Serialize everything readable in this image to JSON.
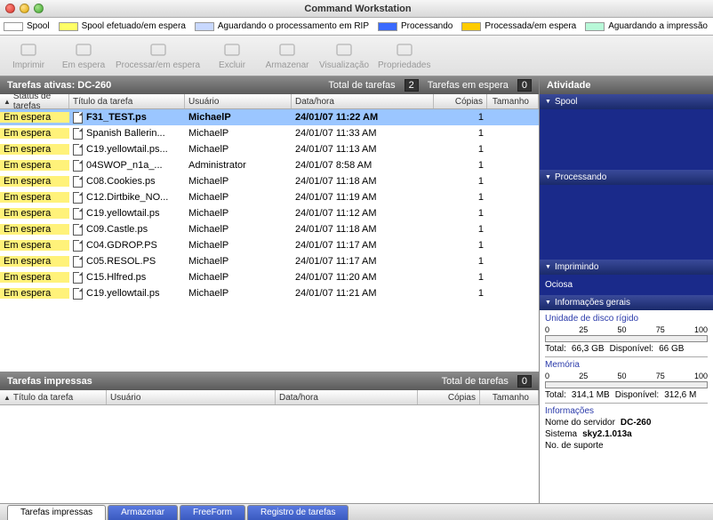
{
  "window": {
    "title": "Command Workstation"
  },
  "legend": [
    {
      "color": "#ffffff",
      "label": "Spool"
    },
    {
      "color": "#ffff66",
      "label": "Spool efetuado/em espera"
    },
    {
      "color": "#c8d8ff",
      "label": "Aguardando o processamento em RIP"
    },
    {
      "color": "#3a6aff",
      "label": "Processando"
    },
    {
      "color": "#ffcc00",
      "label": "Processada/em espera"
    },
    {
      "color": "#b8f8d8",
      "label": "Aguardando a impressão"
    }
  ],
  "toolbar": [
    {
      "name": "print-button",
      "label": "Imprimir"
    },
    {
      "name": "hold-button",
      "label": "Em espera"
    },
    {
      "name": "process-hold-button",
      "label": "Processar/em espera"
    },
    {
      "name": "delete-button",
      "label": "Excluir"
    },
    {
      "name": "archive-button",
      "label": "Armazenar"
    },
    {
      "name": "preview-button",
      "label": "Visualização"
    },
    {
      "name": "properties-button",
      "label": "Propriedades"
    }
  ],
  "active": {
    "header": "Tarefas ativas: DC-260",
    "total_label": "Total de tarefas",
    "total_count": "2",
    "queued_label": "Tarefas em espera",
    "queued_count": "0",
    "columns": {
      "status": "Status de tarefas",
      "title": "Título da tarefa",
      "user": "Usuário",
      "date": "Data/hora",
      "copies": "Cópias",
      "size": "Tamanho"
    },
    "rows": [
      {
        "status": "Em espera",
        "title": "F31_TEST.ps",
        "user": "MichaelP",
        "date": "24/01/07 11:22 AM",
        "copies": "1",
        "selected": true
      },
      {
        "status": "Em espera",
        "title": "Spanish Ballerin...",
        "user": "MichaelP",
        "date": "24/01/07 11:33 AM",
        "copies": "1"
      },
      {
        "status": "Em espera",
        "title": "C19.yellowtail.ps...",
        "user": "MichaelP",
        "date": "24/01/07 11:13 AM",
        "copies": "1"
      },
      {
        "status": "Em espera",
        "title": "04SWOP_n1a_...",
        "user": "Administrator",
        "date": "24/01/07 8:58 AM",
        "copies": "1"
      },
      {
        "status": "Em espera",
        "title": "C08.Cookies.ps",
        "user": "MichaelP",
        "date": "24/01/07 11:18 AM",
        "copies": "1"
      },
      {
        "status": "Em espera",
        "title": "C12.Dirtbike_NO...",
        "user": "MichaelP",
        "date": "24/01/07 11:19 AM",
        "copies": "1"
      },
      {
        "status": "Em espera",
        "title": "C19.yellowtail.ps",
        "user": "MichaelP",
        "date": "24/01/07 11:12 AM",
        "copies": "1"
      },
      {
        "status": "Em espera",
        "title": "C09.Castle.ps",
        "user": "MichaelP",
        "date": "24/01/07 11:18 AM",
        "copies": "1"
      },
      {
        "status": "Em espera",
        "title": "C04.GDROP.PS",
        "user": "MichaelP",
        "date": "24/01/07 11:17 AM",
        "copies": "1"
      },
      {
        "status": "Em espera",
        "title": "C05.RESOL.PS",
        "user": "MichaelP",
        "date": "24/01/07 11:17 AM",
        "copies": "1"
      },
      {
        "status": "Em espera",
        "title": "C15.Hlfred.ps",
        "user": "MichaelP",
        "date": "24/01/07 11:20 AM",
        "copies": "1"
      },
      {
        "status": "Em espera",
        "title": "C19.yellowtail.ps",
        "user": "MichaelP",
        "date": "24/01/07 11:21 AM",
        "copies": "1"
      }
    ]
  },
  "printed": {
    "header": "Tarefas impressas",
    "total_label": "Total de tarefas",
    "total_count": "0",
    "columns": {
      "title": "Título da tarefa",
      "user": "Usuário",
      "date": "Data/hora",
      "copies": "Cópias",
      "size": "Tamanho"
    }
  },
  "activity": {
    "header": "Atividade",
    "sections": {
      "spool": "Spool",
      "processing": "Processando",
      "printing": "Imprimindo"
    },
    "idle": "Ociosa"
  },
  "info": {
    "header": "Informações gerais",
    "hdd_label": "Unidade de disco rígido",
    "ticks": [
      "0",
      "25",
      "50",
      "75",
      "100"
    ],
    "hdd_total_label": "Total:",
    "hdd_total": "66,3 GB",
    "hdd_avail_label": "Disponível:",
    "hdd_avail": "66 GB",
    "mem_label": "Memória",
    "mem_total_label": "Total:",
    "mem_total": "314,1 MB",
    "mem_avail_label": "Disponível:",
    "mem_avail": "312,6 M",
    "info_label": "Informações",
    "server_label": "Nome do servidor",
    "server": "DC-260",
    "system_label": "Sistema",
    "system": "sky2.1.013a",
    "support_label": "No. de suporte"
  },
  "tabs": [
    {
      "label": "Tarefas impressas",
      "active": true
    },
    {
      "label": "Armazenar"
    },
    {
      "label": "FreeForm"
    },
    {
      "label": "Registro de tarefas"
    }
  ]
}
